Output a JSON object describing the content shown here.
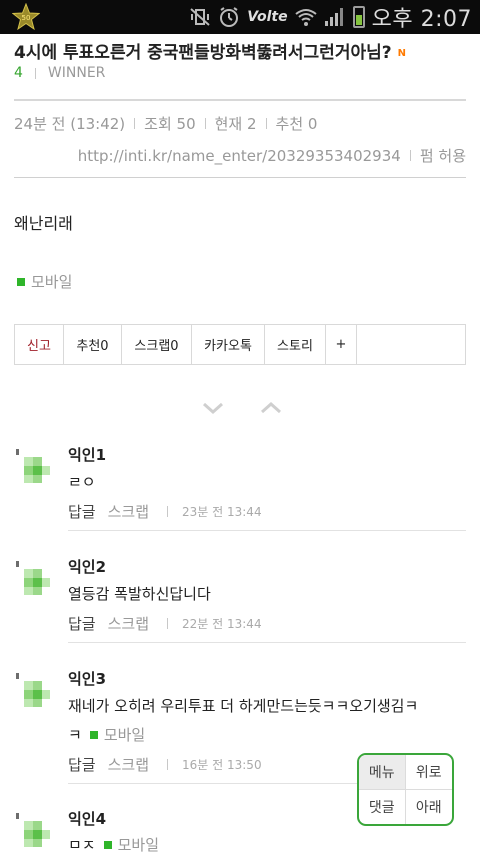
{
  "status_bar": {
    "volte": "Volte",
    "time": "오후 2:07"
  },
  "post": {
    "title": "4시에 투표오른거 중국팬들방화벽뚫려서그런거아님?",
    "new_badge": "N",
    "board_number": "4",
    "board_name": "WINNER",
    "posted": "24분 전 (13:42)",
    "views": "조회 50",
    "current": "현재 2",
    "recommend": "추천 0",
    "url": "http://inti.kr/name_enter/20329353402934",
    "permission": "펌 허용",
    "body": "왜난리래",
    "mobile_label": "모바일"
  },
  "actions": [
    {
      "label": "신고",
      "name": "report-button"
    },
    {
      "label": "추천0",
      "name": "recommend-button"
    },
    {
      "label": "스크랩0",
      "name": "scrap-button"
    },
    {
      "label": "카카오톡",
      "name": "kakaotalk-share-button"
    },
    {
      "label": "스토리",
      "name": "kakaostory-share-button"
    },
    {
      "label": "+",
      "name": "more-share-button"
    }
  ],
  "comments": [
    {
      "author": "익인1",
      "text": "ㄹㅇ",
      "reply": "답글",
      "scrap": "스크랩",
      "time": "23분 전 13:44"
    },
    {
      "author": "익인2",
      "text": "열등감 폭발하신답니다",
      "reply": "답글",
      "scrap": "스크랩",
      "time": "22분 전 13:44"
    },
    {
      "author": "익인3",
      "text": "재네가 오히려 우리투표 더 하게만드는듯ㅋㅋ오기생김ㅋ",
      "text2": "ㅋ",
      "mobile": "모바일",
      "reply": "답글",
      "scrap": "스크랩",
      "time": "16분 전 13:50"
    },
    {
      "author": "익인4",
      "text": "ㅁㅈ",
      "mobile": "모바일"
    }
  ],
  "float_menu": {
    "menu": "메뉴",
    "up": "위로",
    "comments": "댓글",
    "down": "아래"
  },
  "colors": {
    "accent_green": "#2fb52a",
    "report_red": "#a0202a",
    "new_orange": "#ff7a00"
  }
}
